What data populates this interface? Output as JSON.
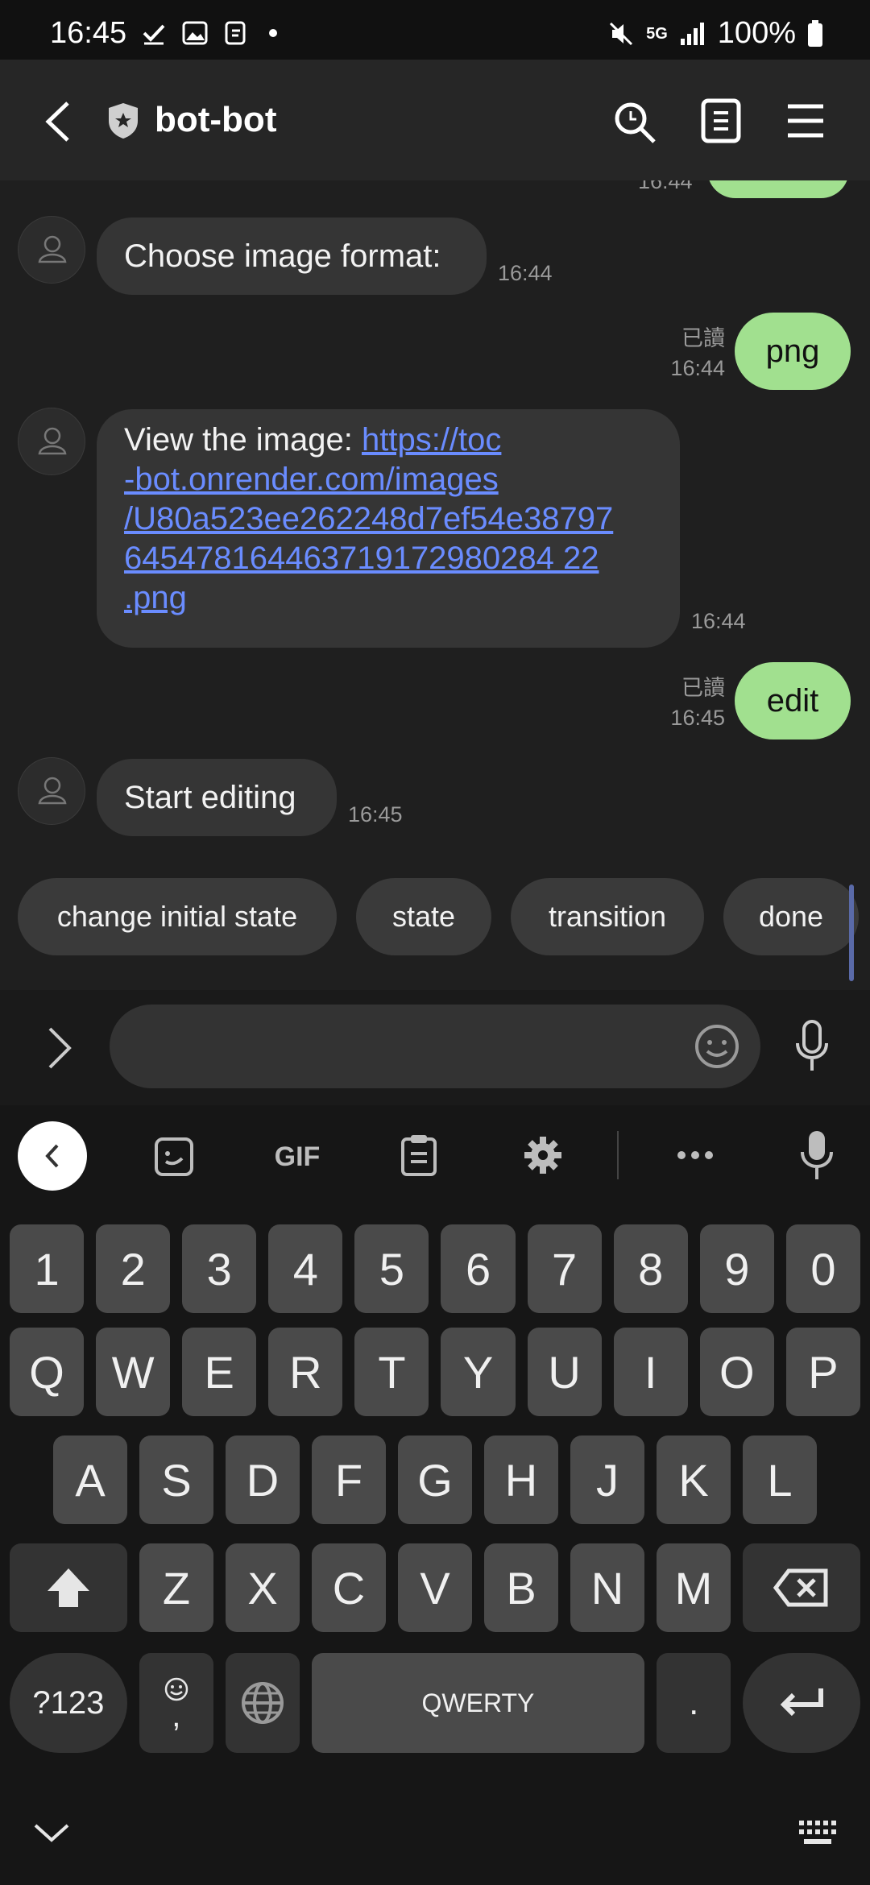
{
  "status_bar": {
    "time": "16:45",
    "network": "5G",
    "battery": "100%"
  },
  "header": {
    "title": "bot-bot"
  },
  "messages": {
    "cut_off_timestamp": "16:44",
    "m1": {
      "text": "Choose image format:",
      "time": "16:44"
    },
    "m2": {
      "text": "png",
      "read": "已讀",
      "time": "16:44"
    },
    "m3": {
      "prefix": "View the image: ",
      "link_lines": [
        "https://toc",
        "-bot.onrender.com/images",
        "/U80a523ee262248d7ef54e38797",
        "645478164463719172980284 22",
        ".png"
      ],
      "time": "16:44"
    },
    "m4": {
      "text": "edit",
      "read": "已讀",
      "time": "16:45"
    },
    "m5": {
      "text": "Start editing",
      "time": "16:45"
    }
  },
  "quick_replies": [
    "change initial state",
    "state",
    "transition",
    "done"
  ],
  "input": {
    "placeholder": ""
  },
  "keyboard": {
    "toolbar": {
      "gif": "GIF"
    },
    "row_numbers": [
      "1",
      "2",
      "3",
      "4",
      "5",
      "6",
      "7",
      "8",
      "9",
      "0"
    ],
    "row_q": [
      "Q",
      "W",
      "E",
      "R",
      "T",
      "Y",
      "U",
      "I",
      "O",
      "P"
    ],
    "row_a": [
      "A",
      "S",
      "D",
      "F",
      "G",
      "H",
      "J",
      "K",
      "L"
    ],
    "row_z": [
      "Z",
      "X",
      "C",
      "V",
      "B",
      "N",
      "M"
    ],
    "symbols_key": "?123",
    "comma_key": ",",
    "space_label": "QWERTY",
    "period_key": "."
  },
  "colors": {
    "outgoing_bubble": "#a1e08f",
    "incoming_bubble": "#353535",
    "link": "#6a8cff"
  }
}
